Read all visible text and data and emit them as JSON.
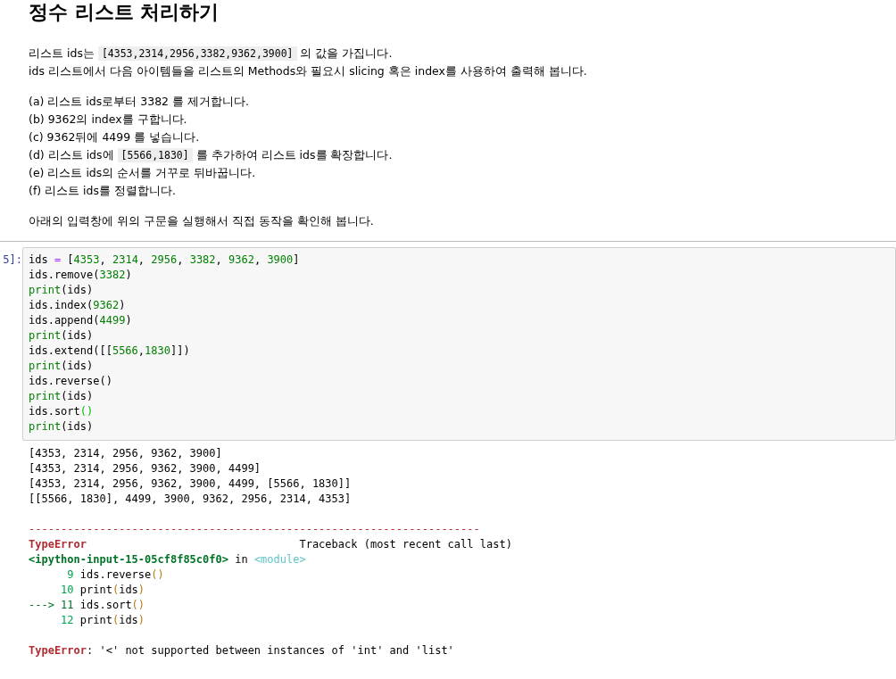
{
  "markdown": {
    "title": "정수 리스트 처리하기",
    "intro": [
      [
        {
          "kind": "text",
          "text": "리스트 ids는 "
        },
        {
          "kind": "code",
          "text": "[4353,2314,2956,3382,9362,3900]"
        },
        {
          "kind": "text",
          "text": " 의 값을 가집니다."
        }
      ],
      [
        {
          "kind": "text",
          "text": "ids 리스트에서 다음 아이템들을 리스트의 Methods와 필요시 slicing 혹은 index를 사용하여 출력해 봅니다."
        }
      ]
    ],
    "tasks": [
      [
        {
          "kind": "text",
          "text": "(a) 리스트 ids로부터 3382 를 제거합니다."
        }
      ],
      [
        {
          "kind": "text",
          "text": "(b) 9362의 index를 구합니다."
        }
      ],
      [
        {
          "kind": "text",
          "text": "(c) 9362뒤에 4499 를 넣습니다."
        }
      ],
      [
        {
          "kind": "text",
          "text": "(d) 리스트 ids에 "
        },
        {
          "kind": "code",
          "text": "[5566,1830]"
        },
        {
          "kind": "text",
          "text": " 를 추가하여 리스트 ids를 확장합니다."
        }
      ],
      [
        {
          "kind": "text",
          "text": "(e) 리스트 ids의 순서를 거꾸로 뒤바꿉니다."
        }
      ],
      [
        {
          "kind": "text",
          "text": "(f) 리스트 ids를 정렬합니다."
        }
      ]
    ],
    "footer": "아래의 입력창에 위의 구문을 실행해서 직접 동작을 확인해 봅니다."
  },
  "code_cell": {
    "prompt": "5]:",
    "lines": [
      [
        {
          "kind": "plain",
          "text": "ids "
        },
        {
          "kind": "op",
          "text": "="
        },
        {
          "kind": "plain",
          "text": " ["
        },
        {
          "kind": "num",
          "text": "4353"
        },
        {
          "kind": "plain",
          "text": ", "
        },
        {
          "kind": "num",
          "text": "2314"
        },
        {
          "kind": "plain",
          "text": ", "
        },
        {
          "kind": "num",
          "text": "2956"
        },
        {
          "kind": "plain",
          "text": ", "
        },
        {
          "kind": "num",
          "text": "3382"
        },
        {
          "kind": "plain",
          "text": ", "
        },
        {
          "kind": "num",
          "text": "9362"
        },
        {
          "kind": "plain",
          "text": ", "
        },
        {
          "kind": "num",
          "text": "3900"
        },
        {
          "kind": "plain",
          "text": "]"
        }
      ],
      [
        {
          "kind": "plain",
          "text": "ids.remove("
        },
        {
          "kind": "num",
          "text": "3382"
        },
        {
          "kind": "plain",
          "text": ")"
        }
      ],
      [
        {
          "kind": "builtin",
          "text": "print"
        },
        {
          "kind": "plain",
          "text": "(ids)"
        }
      ],
      [
        {
          "kind": "plain",
          "text": "ids.index("
        },
        {
          "kind": "num",
          "text": "9362"
        },
        {
          "kind": "plain",
          "text": ")"
        }
      ],
      [
        {
          "kind": "plain",
          "text": "ids.append("
        },
        {
          "kind": "num",
          "text": "4499"
        },
        {
          "kind": "plain",
          "text": ")"
        }
      ],
      [
        {
          "kind": "builtin",
          "text": "print"
        },
        {
          "kind": "plain",
          "text": "(ids)"
        }
      ],
      [
        {
          "kind": "plain",
          "text": "ids.extend([["
        },
        {
          "kind": "num",
          "text": "5566"
        },
        {
          "kind": "plain",
          "text": ","
        },
        {
          "kind": "num",
          "text": "1830"
        },
        {
          "kind": "plain",
          "text": "]])"
        }
      ],
      [
        {
          "kind": "builtin",
          "text": "print"
        },
        {
          "kind": "plain",
          "text": "(ids)"
        }
      ],
      [
        {
          "kind": "plain",
          "text": "ids.reverse()"
        }
      ],
      [
        {
          "kind": "builtin",
          "text": "print"
        },
        {
          "kind": "plain",
          "text": "(ids)"
        }
      ],
      [
        {
          "kind": "plain",
          "text": "ids.sort"
        },
        {
          "kind": "bracket",
          "text": "()"
        }
      ],
      [
        {
          "kind": "builtin",
          "text": "print"
        },
        {
          "kind": "plain",
          "text": "(ids)"
        }
      ]
    ]
  },
  "output": {
    "stdout": [
      "[4353, 2314, 2956, 9362, 3900]",
      "[4353, 2314, 2956, 9362, 3900, 4499]",
      "[4353, 2314, 2956, 9362, 3900, 4499, [5566, 1830]]",
      "[[5566, 1830], 4499, 3900, 9362, 2956, 2314, 4353]"
    ],
    "traceback": [
      {
        "tokens": [
          {
            "kind": "error",
            "text": "----------------------------------------------------------------------"
          }
        ]
      },
      {
        "tokens": [
          {
            "kind": "error",
            "text": "TypeError"
          },
          {
            "kind": "plain",
            "text": "                                 Traceback (most recent call last)"
          }
        ]
      },
      {
        "tokens": [
          {
            "kind": "file",
            "text": "<ipython-input-15-05cf8f85c0f0>"
          },
          {
            "kind": "plain",
            "text": " in "
          },
          {
            "kind": "module",
            "text": "<module>"
          }
        ]
      },
      {
        "tokens": [
          {
            "kind": "lineno",
            "text": "9"
          },
          {
            "kind": "plain",
            "text": " ids.reverse"
          },
          {
            "kind": "paren",
            "text": "()"
          }
        ]
      },
      {
        "tokens": [
          {
            "kind": "lineno",
            "text": "10"
          },
          {
            "kind": "plain",
            "text": " print"
          },
          {
            "kind": "paren",
            "text": "("
          },
          {
            "kind": "plain",
            "text": "ids"
          },
          {
            "kind": "paren",
            "text": ")"
          }
        ]
      },
      {
        "tokens": [
          {
            "kind": "arrow",
            "text": "---> 11"
          },
          {
            "kind": "plain",
            "text": " ids.sort"
          },
          {
            "kind": "paren",
            "text": "()"
          }
        ]
      },
      {
        "tokens": [
          {
            "kind": "lineno",
            "text": "12"
          },
          {
            "kind": "plain",
            "text": " print"
          },
          {
            "kind": "paren",
            "text": "("
          },
          {
            "kind": "plain",
            "text": "ids"
          },
          {
            "kind": "paren",
            "text": ")"
          }
        ]
      }
    ],
    "error_message": [
      {
        "kind": "error",
        "text": "TypeError"
      },
      {
        "kind": "plain",
        "text": ": '<' not supported between instances of 'int' and 'list'"
      }
    ]
  }
}
